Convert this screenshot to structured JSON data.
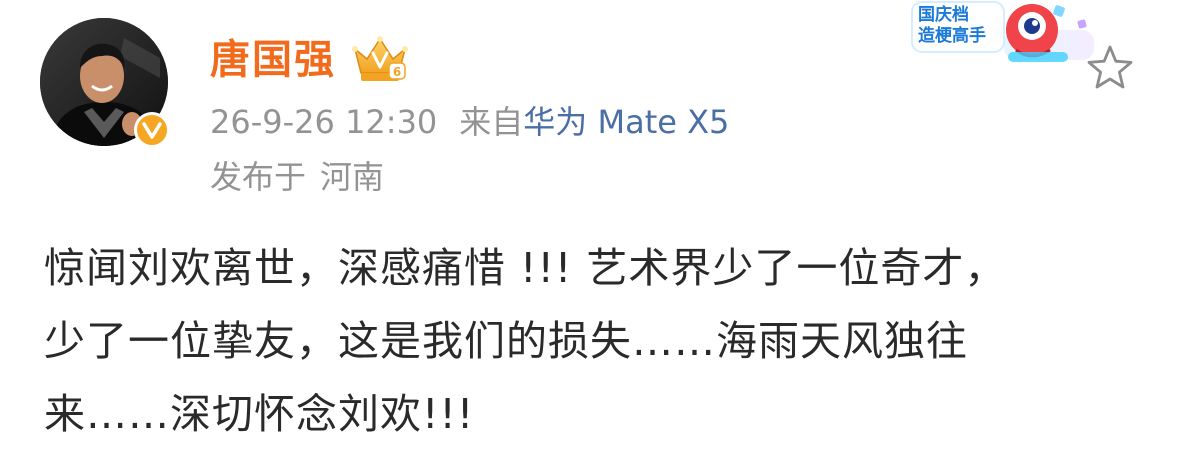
{
  "post": {
    "author": {
      "name": "唐国强"
    },
    "timestamp": "26-9-26 12:30",
    "source_prefix": "来自",
    "source_device": "华为 Mate X5",
    "location_label": "发布于",
    "location": "河南",
    "body_lines": [
      "惊闻刘欢离世，深感痛惜 !!!  艺术界少了一位奇才，",
      "少了一位挚友，这是我们的损失……海雨天风独往",
      "来……深切怀念刘欢!!!"
    ]
  },
  "promo": {
    "line1": "国庆档",
    "line2": "造梗高手"
  },
  "colors": {
    "author_name": "#f26a1b",
    "meta_text": "#939393",
    "device_link": "#4a6fa5",
    "body_text": "#2a2a2a",
    "verified_badge": "#f5a623"
  },
  "icons": {
    "verified": "verified-v-icon",
    "vip": "vip-crown-icon",
    "favorite": "star-outline-icon"
  }
}
